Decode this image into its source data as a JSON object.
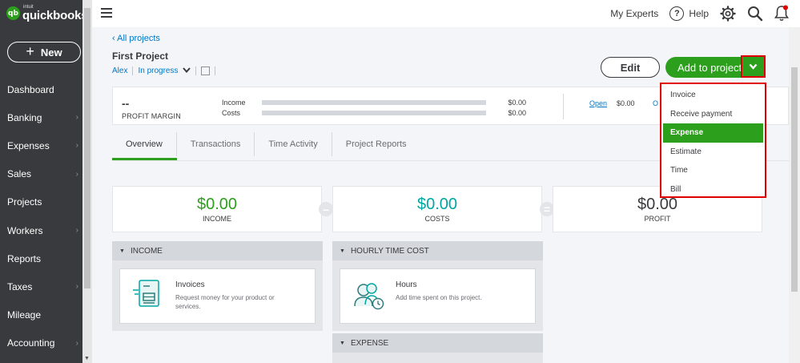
{
  "brand": {
    "badge": "qb",
    "small": "intuit",
    "name": "quickbooks"
  },
  "sidebar": {
    "new_label": "New",
    "items": [
      {
        "label": "Dashboard",
        "chevron": false
      },
      {
        "label": "Banking",
        "chevron": true
      },
      {
        "label": "Expenses",
        "chevron": true
      },
      {
        "label": "Sales",
        "chevron": true
      },
      {
        "label": "Projects",
        "chevron": false
      },
      {
        "label": "Workers",
        "chevron": true
      },
      {
        "label": "Reports",
        "chevron": false
      },
      {
        "label": "Taxes",
        "chevron": true
      },
      {
        "label": "Mileage",
        "chevron": false
      },
      {
        "label": "Accounting",
        "chevron": true
      }
    ]
  },
  "topbar": {
    "experts": "My Experts",
    "help": "Help",
    "help_glyph": "?"
  },
  "project": {
    "back": "All projects",
    "title": "First Project",
    "customer": "Alex",
    "status": "In progress"
  },
  "actions": {
    "edit": "Edit",
    "add": "Add to project"
  },
  "summary": {
    "margin_value": "--",
    "margin_label": "PROFIT MARGIN",
    "income_label": "Income",
    "income_amount": "$0.00",
    "costs_label": "Costs",
    "costs_amount": "$0.00",
    "open_label": "Open",
    "open_amount": "$0.00",
    "overdue_label": "O"
  },
  "tabs": [
    "Overview",
    "Transactions",
    "Time Activity",
    "Project Reports"
  ],
  "totals": {
    "income": {
      "value": "$0.00",
      "label": "INCOME"
    },
    "costs": {
      "value": "$0.00",
      "label": "COSTS"
    },
    "profit": {
      "value": "$0.00",
      "label": "PROFIT"
    }
  },
  "sections": {
    "income": {
      "title": "INCOME",
      "tile_title": "Invoices",
      "tile_desc": "Request money for your product or services."
    },
    "hourly": {
      "title": "HOURLY TIME COST",
      "tile_title": "Hours",
      "tile_desc": "Add time spent on this project."
    },
    "expense": {
      "title": "EXPENSE"
    }
  },
  "dropdown": {
    "items": [
      "Invoice",
      "Receive payment",
      "Expense",
      "Estimate",
      "Time",
      "Bill"
    ],
    "highlighted": "Expense"
  },
  "colors": {
    "green": "#2ca01c",
    "teal": "#00a6a4",
    "highlight_red": "#e00000",
    "sidebar": "#393a3d"
  }
}
